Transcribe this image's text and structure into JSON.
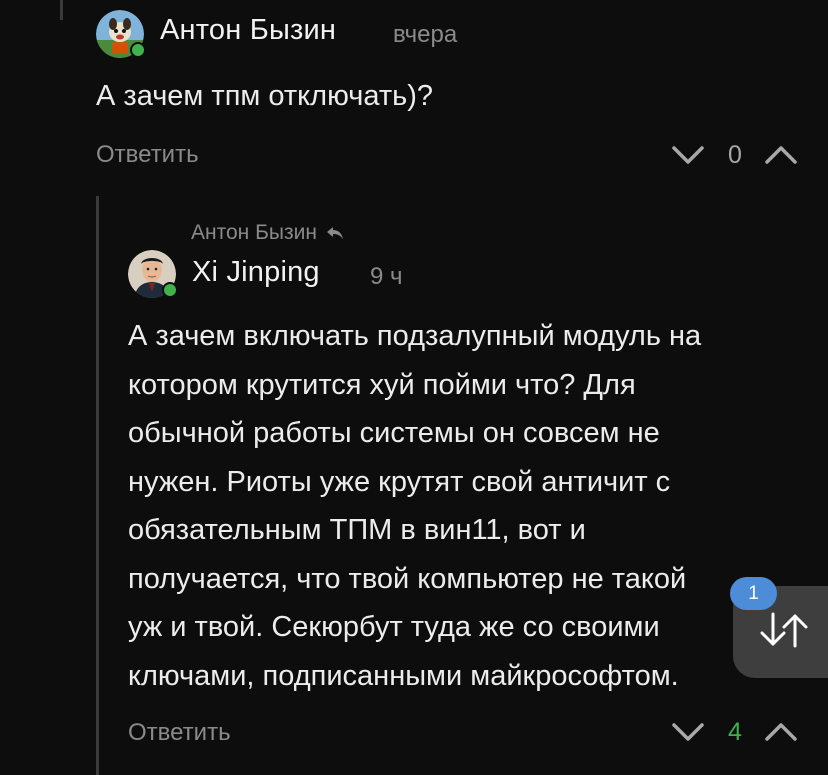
{
  "comments": [
    {
      "author": "Антон Бызин",
      "time": "вчера",
      "text": "А зачем тпм отключать)?",
      "reply_label": "Ответить",
      "rating": "0",
      "avatar_icon": "cartoon-avatar-icon",
      "online": true
    },
    {
      "parent_author": "Антон Бызин",
      "author": "Xi Jinping",
      "time": "9 ч",
      "text_lines": [
        "А зачем включать подзалупный модуль на",
        "котором крутится хуй пойми что? Для",
        "обычной работы системы он совсем не",
        "нужен. Риоты уже крутят свой античит с",
        "обязательным ТПМ в вин11, вот и",
        "получается, что твой компьютер не такой",
        "уж и твой. Секюрбут туда же со своими",
        "ключами, подписанными майкрософтом."
      ],
      "reply_label": "Ответить",
      "rating": "4",
      "avatar_icon": "portrait-avatar-icon",
      "online": true
    }
  ],
  "scroll_widget": {
    "badge": "1",
    "icon": "sort-arrows-icon"
  },
  "colors": {
    "background": "#0d0d0d",
    "text": "#ececec",
    "muted": "#8a8a8a",
    "positive": "#3fb24a",
    "badge": "#4d8cd6",
    "thread_line": "#3a3a3a"
  }
}
